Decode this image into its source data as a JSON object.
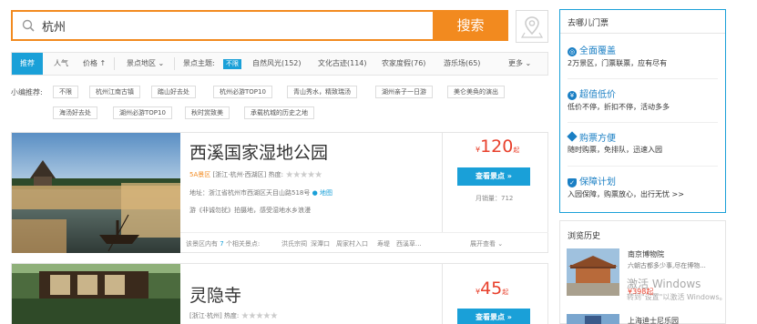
{
  "search": {
    "value": "杭州",
    "button_label": "搜索"
  },
  "filters": {
    "recommend": "推荐",
    "popularity": "人气",
    "price": "价格",
    "area": "景点地区",
    "theme_label": "景点主题:",
    "theme_nolimit": "不限",
    "themes": [
      "自然风光(152)",
      "文化古迹(114)",
      "农家度假(76)",
      "游乐场(65)"
    ],
    "more": "更多"
  },
  "editor_recs": {
    "label": "小编推荐:",
    "tags_row1": [
      "不限",
      "杭州江南古镇",
      "踏山好去处",
      "杭州必游TOP10",
      "青山秀水，精致瑞汤",
      "湖州亲子一日游",
      "美仑美奂的演出"
    ],
    "tags_row2": [
      "海汤好去处",
      "湖州必游TOP10",
      "秋时赏致美",
      "承载杭城的历史之地"
    ]
  },
  "listings": [
    {
      "title": "西溪国家湿地公园",
      "grade": "5A景区",
      "region": "[浙江·杭州·西湖区]",
      "heat_label": "热度:",
      "address": "地址：浙江省杭州市西湖区天目山路518号",
      "map_link": "地图",
      "desc": "游《非诚勿扰》拍摄地，感受湿地水乡浪漫",
      "price_currency": "¥",
      "price": "120",
      "price_suffix": "起",
      "view_button": "查看景点 »",
      "sales": "月销量：712",
      "footer_prefix": "该景区内有",
      "footer_count": "7",
      "footer_suffix": "个相关景点:",
      "sub_spots": [
        "洪氏宗祠",
        "深潭口",
        "周家村入口",
        "寿堤",
        "西溪草..."
      ],
      "expand": "展开查看"
    },
    {
      "title": "灵隐寺",
      "region": "[浙江·杭州]",
      "heat_label": "热度:",
      "price_currency": "¥",
      "price": "45",
      "price_suffix": "起",
      "view_button": "查看景点 »"
    }
  ],
  "ticket_panel": {
    "title": "去哪儿门票",
    "features": [
      {
        "icon": "globe-icon",
        "title": "全面覆盖",
        "desc": "2万景区，门票联票，应有尽有"
      },
      {
        "icon": "yen-icon",
        "title": "超值低价",
        "desc": "低价不停，折扣不停，活动多多"
      },
      {
        "icon": "diamond-icon",
        "title": "购票方便",
        "desc": "随时购票，免排队，迅速入园"
      },
      {
        "icon": "shield-icon",
        "title": "保障计划",
        "desc": "入园保障，购票放心，出行无忧 >>"
      }
    ]
  },
  "history": {
    "title": "浏览历史",
    "items": [
      {
        "name": "南京博物院",
        "desc": "六朝古都多少事,尽在博物...",
        "price": "¥398起"
      },
      {
        "name": "上海迪士尼乐园"
      }
    ]
  },
  "watermark": {
    "line1": "激活 Windows",
    "line2": "转到\"设置\"以激活 Windows。"
  },
  "colors": {
    "accent_orange": "#f28a1f",
    "accent_blue": "#1aa0d8",
    "price_red": "#e8402c"
  }
}
